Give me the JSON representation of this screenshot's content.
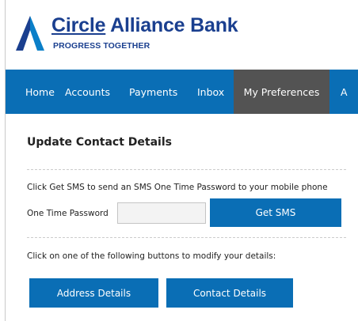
{
  "header": {
    "brand_part1": "Circle",
    "brand_part2": " Alliance Bank",
    "tagline": "PROGRESS TOGETHER",
    "brand_color": "#1a3f8f",
    "accent_color": "#0a6eb5"
  },
  "nav": {
    "items": [
      {
        "label": "Home"
      },
      {
        "label": "Accounts"
      },
      {
        "label": "Payments"
      },
      {
        "label": "Inbox"
      },
      {
        "label": "My Preferences",
        "active": true
      },
      {
        "label": "A"
      }
    ],
    "background": "#0a6eb5",
    "active_background": "#535353"
  },
  "main": {
    "title": "Update Contact Details",
    "sms_instruction": "Click Get SMS to send an SMS One Time Password to your mobile phone",
    "otp_label": "One Time Password",
    "otp_value": "",
    "get_sms_label": "Get SMS",
    "modify_instruction": "Click on one of the following buttons to modify your details:",
    "address_button_label": "Address Details",
    "contact_button_label": "Contact Details"
  }
}
